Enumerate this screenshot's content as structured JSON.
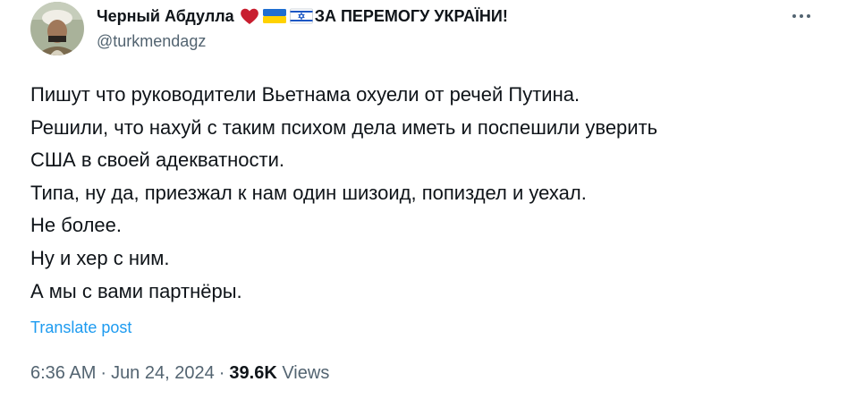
{
  "tweet": {
    "author": {
      "name": "Черный Абдулла",
      "name_suffix": "ЗА ПЕРЕМОГУ УКРАЇНИ!",
      "handle": "@turkmendagz",
      "emojis": [
        "red-heart",
        "ukraine-flag",
        "israel-flag"
      ]
    },
    "lines": [
      "Пишут что руководители Вьетнама охуели от речей Путина.",
      "Решили, что нахуй с таким психом дела иметь и поспешили уверить",
      "США в своей адекватности.",
      "Типа, ну да, приезжал к нам один шизоид, попиздел и уехал.",
      "Не более.",
      "Ну и хер с ним.",
      "А мы с вами партнёры."
    ],
    "translate_label": "Translate post",
    "time": "6:36 AM",
    "date": "Jun 24, 2024",
    "separator": "·",
    "views_count": "39.6K",
    "views_label": "Views"
  },
  "colors": {
    "text_primary": "#0f1419",
    "text_secondary": "#536471",
    "link": "#1d9bf0",
    "heart": "#d0021b"
  }
}
